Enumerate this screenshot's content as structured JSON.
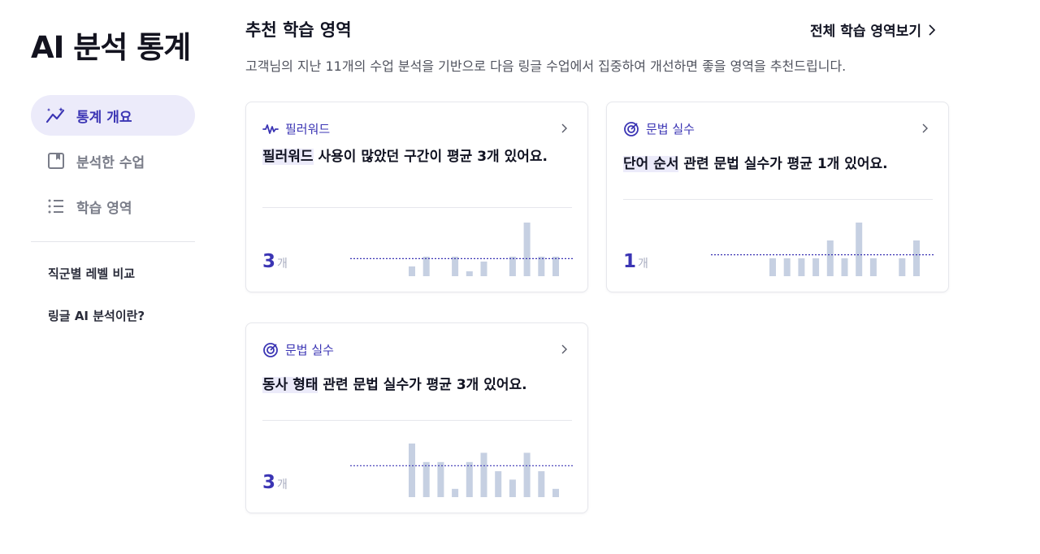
{
  "sidebar": {
    "title": "AI 분석 통계",
    "nav": [
      {
        "label": "통계 개요",
        "icon": "sparkline-icon",
        "active": true
      },
      {
        "label": "분석한 수업",
        "icon": "bookmark-icon",
        "active": false
      },
      {
        "label": "학습 영역",
        "icon": "list-icon",
        "active": false
      }
    ],
    "links": [
      "직군별 레벨 비교",
      "링글 AI 분석이란?"
    ]
  },
  "main": {
    "title": "추천 학습 영역",
    "see_all": "전체 학습 영역보기",
    "description": "고객님의 지난 11개의 수업 분석을 기반으로 다음 링글 수업에서 집중하여 개선하면 좋을 영역을 추천드립니다."
  },
  "colors": {
    "accent": "#3b35b4",
    "highlight": "#ecebfa",
    "bar": "#c6d0e2",
    "average_line": "#3b35b4"
  },
  "cards": [
    {
      "category": "필러워드",
      "icon": "waveform-icon",
      "summary_highlight": "필러워드",
      "summary_rest": " 사용이 많았던 구간이 평균 3개 있어요.",
      "count": "3",
      "unit": "개",
      "chart_data": {
        "type": "bar",
        "values": [
          1,
          2,
          0,
          2,
          0.5,
          1.5,
          0,
          2,
          5.5,
          2,
          2
        ],
        "average": 1.8
      }
    },
    {
      "category": "문법 실수",
      "icon": "target-icon",
      "summary_highlight": "단어 순서",
      "summary_rest": " 관련 문법 실수가 평균 1개 있어요.",
      "count": "1",
      "unit": "개",
      "chart_data": {
        "type": "bar",
        "values": [
          1,
          1,
          1,
          1,
          2,
          1,
          3,
          1,
          0,
          1,
          2
        ],
        "average": 1.2
      }
    },
    {
      "category": "문법 실수",
      "icon": "target-icon",
      "summary_highlight": "동사 형태",
      "summary_rest": " 관련 문법 실수가 평균 3개 있어요.",
      "count": "3",
      "unit": "개",
      "chart_data": {
        "type": "bar",
        "values": [
          5.8,
          3.8,
          3.8,
          0.9,
          3.8,
          4.8,
          2.8,
          1.9,
          4.8,
          2.8,
          0.9
        ],
        "average": 3.4
      }
    }
  ]
}
